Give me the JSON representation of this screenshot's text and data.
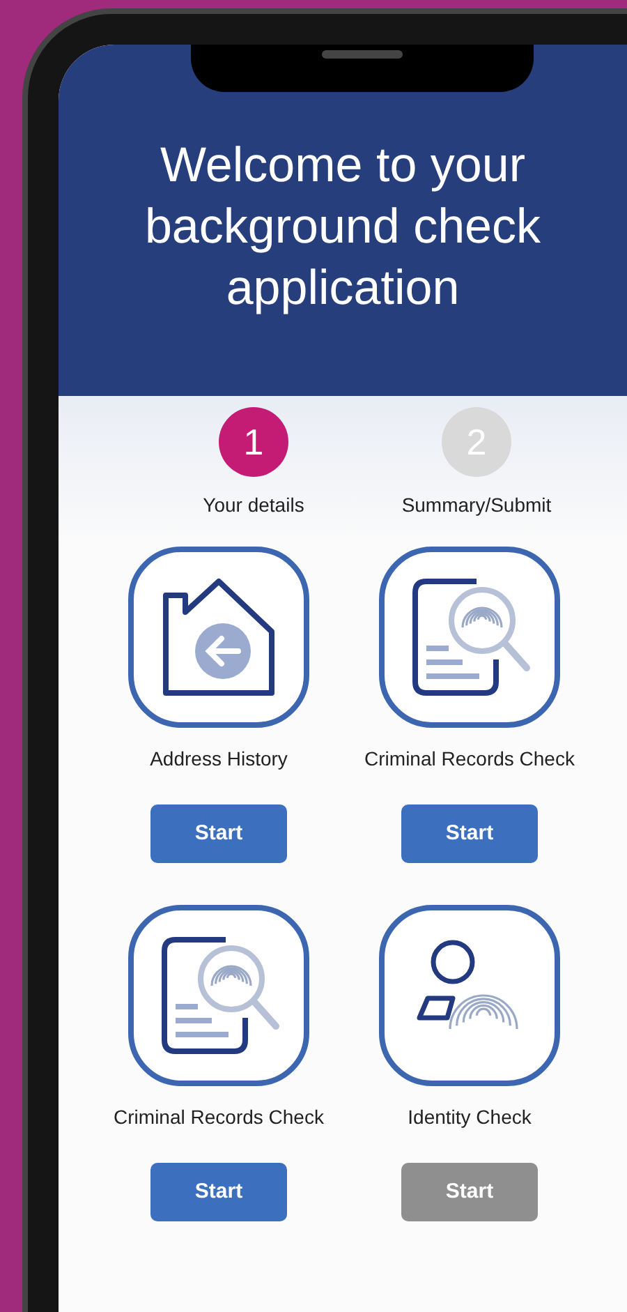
{
  "header": {
    "title": "Welcome to your background check application"
  },
  "steps": [
    {
      "number": "1",
      "label": "Your details",
      "selected": true
    },
    {
      "number": "2",
      "label": "Summary/Submit",
      "selected": false
    }
  ],
  "cards": [
    {
      "kind": "house",
      "label": "Address History",
      "button": "Start",
      "disabled": false
    },
    {
      "kind": "records",
      "label": "Criminal Records Check",
      "button": "Start",
      "disabled": false
    },
    {
      "kind": "records",
      "label": "Criminal Records Check",
      "button": "Start",
      "disabled": false
    },
    {
      "kind": "identity",
      "label": "Identity Check",
      "button": "Start",
      "disabled": true
    }
  ]
}
